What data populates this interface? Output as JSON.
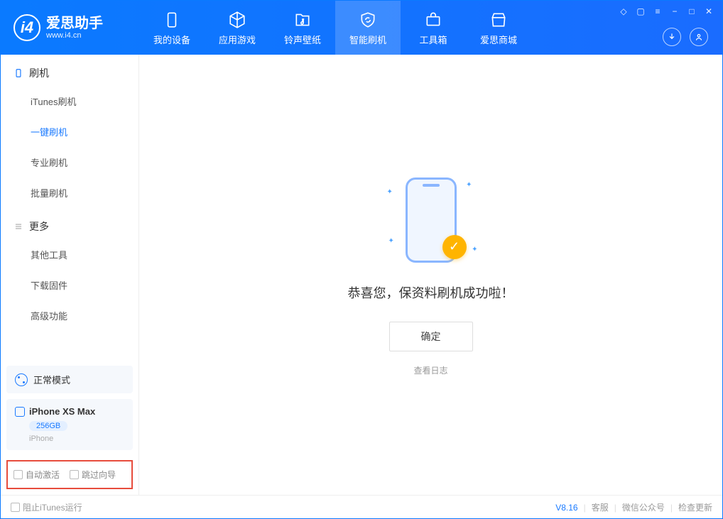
{
  "app": {
    "logo_title": "爱思助手",
    "logo_sub": "www.i4.cn"
  },
  "tabs": {
    "device": "我的设备",
    "apps": "应用游戏",
    "ringtones": "铃声壁纸",
    "flash": "智能刷机",
    "toolbox": "工具箱",
    "store": "爱思商城"
  },
  "sidebar": {
    "section1": "刷机",
    "items1": {
      "itunes": "iTunes刷机",
      "oneclick": "一键刷机",
      "pro": "专业刷机",
      "batch": "批量刷机"
    },
    "section2": "更多",
    "items2": {
      "other": "其他工具",
      "firmware": "下载固件",
      "advanced": "高级功能"
    }
  },
  "device_panel": {
    "mode_label": "正常模式",
    "device_name": "iPhone XS Max",
    "storage": "256GB",
    "device_type": "iPhone"
  },
  "bottom_checks": {
    "auto_activate": "自动激活",
    "skip_guide": "跳过向导"
  },
  "main": {
    "success_text": "恭喜您，保资料刷机成功啦！",
    "confirm": "确定",
    "view_log": "查看日志"
  },
  "footer": {
    "block_itunes": "阻止iTunes运行",
    "version": "V8.16",
    "support": "客服",
    "wechat": "微信公众号",
    "update": "检查更新"
  }
}
